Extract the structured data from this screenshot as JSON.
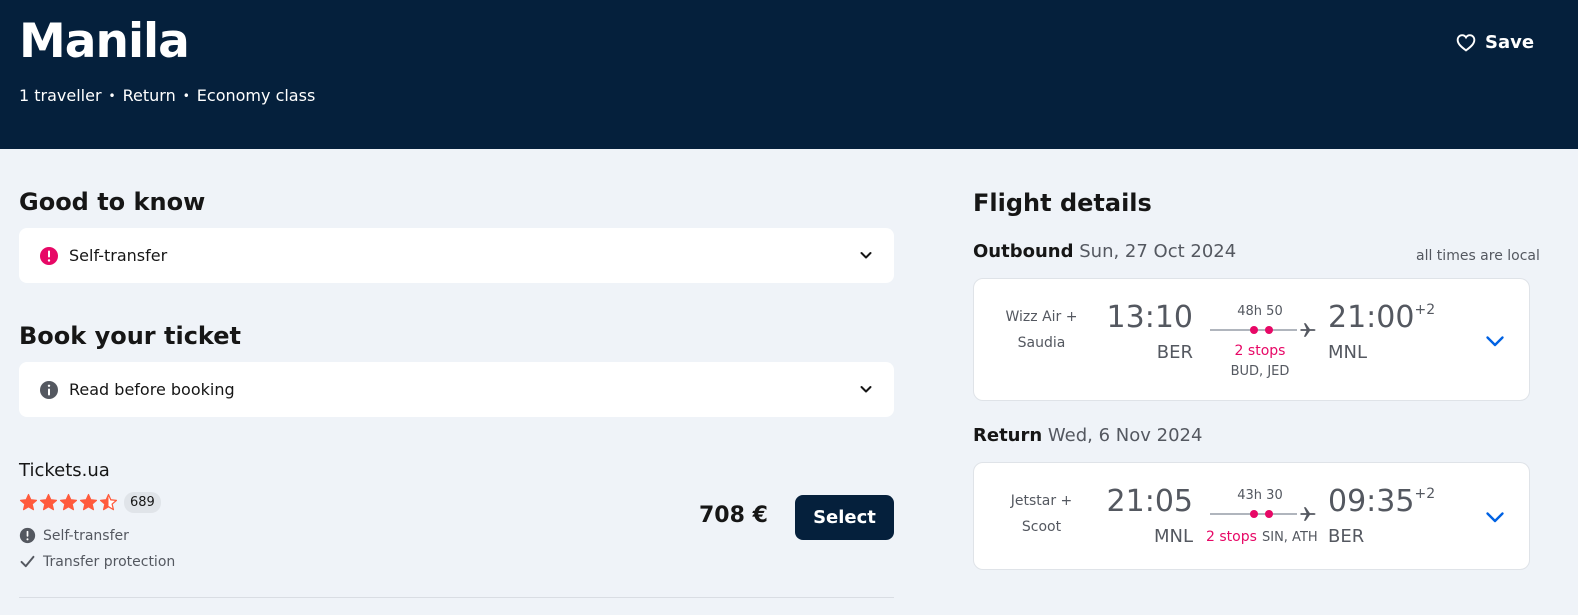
{
  "header": {
    "title": "Manila",
    "travellers": "1 traveller",
    "trip_type": "Return",
    "cabin": "Economy class",
    "separator": "•",
    "save_label": "Save"
  },
  "good_to_know": {
    "title": "Good to know",
    "item_label": "Self-transfer"
  },
  "book": {
    "title": "Book your ticket",
    "item_label": "Read before booking"
  },
  "provider": {
    "name": "Tickets.ua",
    "rating": 4.5,
    "review_count": "689",
    "features": [
      "Self-transfer",
      "Transfer protection"
    ],
    "price": "708 €",
    "select_label": "Select"
  },
  "flight_details": {
    "title": "Flight details",
    "local_note": "all times are local",
    "outbound": {
      "label": "Outbound",
      "date": "Sun, 27 Oct 2024",
      "airline_line1": "Wizz Air +",
      "airline_line2": "Saudia",
      "depart_time": "13:10",
      "depart_code": "BER",
      "duration": "48h 50",
      "stops": "2 stops",
      "via": "BUD, JED",
      "arrive_time": "21:00",
      "day_offset": "+2",
      "arrive_code": "MNL"
    },
    "return": {
      "label": "Return",
      "date": "Wed, 6 Nov 2024",
      "airline_line1": "Jetstar +",
      "airline_line2": "Scoot",
      "depart_time": "21:05",
      "depart_code": "MNL",
      "duration": "43h 30",
      "stops": "2 stops",
      "via": "SIN, ATH",
      "arrive_time": "09:35",
      "day_offset": "+2",
      "arrive_code": "BER"
    }
  },
  "colors": {
    "header_bg": "#05203c",
    "accent_pink": "#e70866",
    "star_orange": "#ff5a3c",
    "link_blue": "#0062e3"
  },
  "icons": [
    "heart-icon",
    "alert-circle-icon",
    "info-circle-icon",
    "chevron-down-icon",
    "star-icon",
    "check-icon",
    "plane-icon"
  ]
}
